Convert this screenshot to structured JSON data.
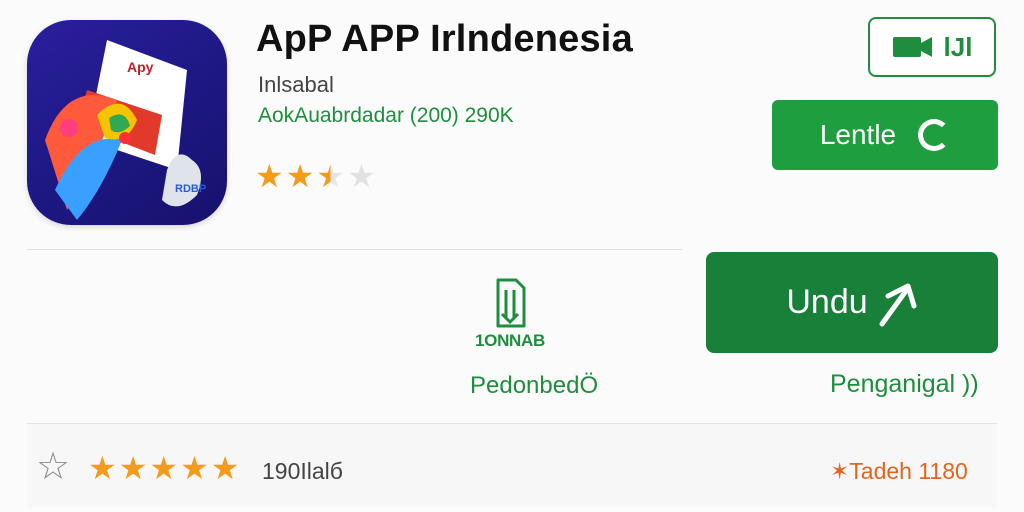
{
  "app": {
    "title": "ApP APP Irlndenesia",
    "developer": "Inlsabal",
    "meta": "AokAuabrdadar (200) 290K",
    "icon_name": "app-icon-logo",
    "icon_text_top": "Apy",
    "icon_text_bottom": "RDBP",
    "rating_top": 2.5
  },
  "actions": {
    "outline_button_label": "lJl",
    "outline_button_icon": "camera-icon",
    "lentie_label": "Lentle",
    "lentie_icon": "refresh-icon",
    "unduh_label": "Undu",
    "unduh_icon": "arrow-up-right-icon",
    "pengangkal_link": "Penganigal ))"
  },
  "stat": {
    "icon": "file-icon",
    "value": "1ONNAB",
    "link": "PedonbedÖ"
  },
  "footer": {
    "bookmark_icon": "star-outline-icon",
    "rating": 5,
    "review_count": "190Ilalб",
    "tag": "✶Tadeh 1180"
  },
  "colors": {
    "accent_green": "#1e8e3e",
    "button_green": "#1e9e3e",
    "button_dark_green": "#188038",
    "star_orange": "#f29b1d",
    "tag_orange": "#e0651f",
    "icon_bg": "#1d1782"
  }
}
